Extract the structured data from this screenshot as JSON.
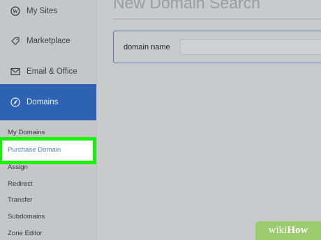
{
  "sidebar": {
    "nav": [
      {
        "label": "My Sites",
        "icon": "wordpress-icon"
      },
      {
        "label": "Marketplace",
        "icon": "tag-icon"
      },
      {
        "label": "Email & Office",
        "icon": "envelope-icon"
      },
      {
        "label": "Domains",
        "icon": "compass-icon",
        "active": true
      }
    ],
    "sub_items": [
      {
        "label": "My Domains"
      },
      {
        "label": "Purchase Domain",
        "highlighted": true
      },
      {
        "label": "Assign"
      },
      {
        "label": "Redirect"
      },
      {
        "label": "Transfer"
      },
      {
        "label": "Subdomains"
      },
      {
        "label": "Zone Editor"
      }
    ]
  },
  "main": {
    "title": "New Domain Search",
    "search": {
      "label": "domain name",
      "value": ""
    }
  },
  "watermark": {
    "part1": "wiki",
    "part2": "How"
  },
  "colors": {
    "active_nav": "#2e62b3",
    "highlight_border": "#1cf00a",
    "link_blue": "#4f7fc4",
    "panel_border": "#5a77a5"
  }
}
